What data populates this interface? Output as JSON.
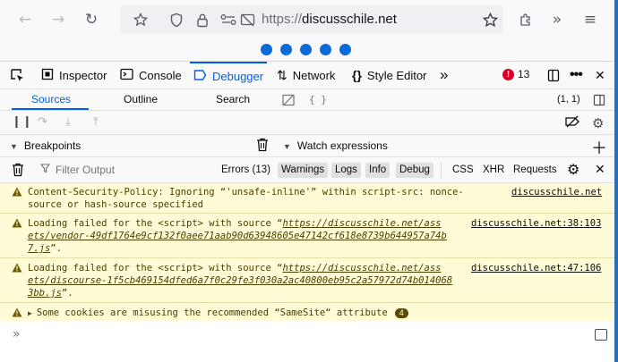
{
  "browser": {
    "url_protocol": "https://",
    "url_domain": "discusschile.net"
  },
  "devtools": {
    "tabs": [
      {
        "label": "Inspector"
      },
      {
        "label": "Console"
      },
      {
        "label": "Debugger"
      },
      {
        "label": "Network"
      },
      {
        "label": "Style Editor"
      }
    ],
    "error_count": "13",
    "sub_tabs": [
      "Sources",
      "Outline",
      "Search"
    ],
    "editor_braces": "{ }",
    "cursor_position": "(1, 1)",
    "breakpoints_label": "Breakpoints",
    "watch_label": "Watch expressions"
  },
  "console": {
    "filter_placeholder": "Filter Output",
    "filters": [
      "Errors (13)",
      "Warnings",
      "Logs",
      "Info",
      "Debug"
    ],
    "request_filters": [
      "CSS",
      "XHR",
      "Requests"
    ],
    "messages": [
      {
        "line1": "Content-Security-Policy: Ignoring “'unsafe-inline'” within script-src: nonce-",
        "line2": "source or hash-source specified",
        "source": "discusschile.net"
      },
      {
        "line1_pre": "Loading failed for the <script> with source “",
        "line1_link": "https://discusschile.net/ass",
        "line2_link": "ets/vendor-49df1764e9cf132f0aee71aab90d63948605e47142cf618e8739b644957a74b",
        "line3_link": "7.js",
        "line3_post": "”.",
        "source": "discusschile.net:38:103"
      },
      {
        "line1_pre": "Loading failed for the <script> with source “",
        "line1_link": "https://discusschile.net/ass",
        "line2_link": "ets/discourse-1f5cb469154dfed6a7f0c29fe3f030a2ac40800eb95c2a57972d74b014068",
        "line3_link": "3bb.js",
        "line3_post": "”.",
        "source": "discusschile.net:47:106"
      },
      {
        "text": "Some cookies are misusing the recommended “SameSite“ attribute",
        "count": "4"
      }
    ]
  },
  "colors": {
    "accent": "#0060df",
    "warning_bg": "#fffbd6",
    "error_red": "#d70022"
  }
}
